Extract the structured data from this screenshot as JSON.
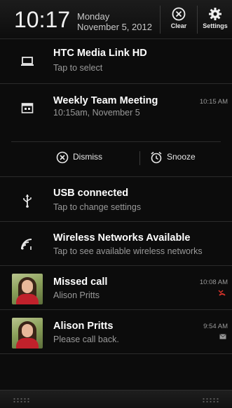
{
  "status": {
    "time": "10:17",
    "day": "Monday",
    "date": "November 5, 2012",
    "clear_label": "Clear",
    "settings_label": "Settings"
  },
  "notifications": [
    {
      "title": "HTC Media Link HD",
      "subtitle": "Tap to select",
      "icon": "laptop-icon"
    },
    {
      "title": "Weekly Team Meeting",
      "subtitle": "10:15am, November 5",
      "time": "10:15 AM",
      "icon": "calendar-icon",
      "actions": {
        "dismiss": "Dismiss",
        "snooze": "Snooze"
      }
    },
    {
      "title": "USB connected",
      "subtitle": "Tap to change settings",
      "icon": "usb-icon"
    },
    {
      "title": "Wireless Networks Available",
      "subtitle": "Tap to see available wireless networks",
      "icon": "wifi-icon"
    },
    {
      "title": "Missed call",
      "subtitle": "Alison Pritts",
      "time": "10:08 AM",
      "icon": "missed-call-icon"
    },
    {
      "title": "Alison Pritts",
      "subtitle": "Please call back.",
      "time": "9:54 AM",
      "icon": "message-icon"
    }
  ],
  "colors": {
    "background": "#0c0c0c",
    "missed_call": "#d9342b"
  }
}
